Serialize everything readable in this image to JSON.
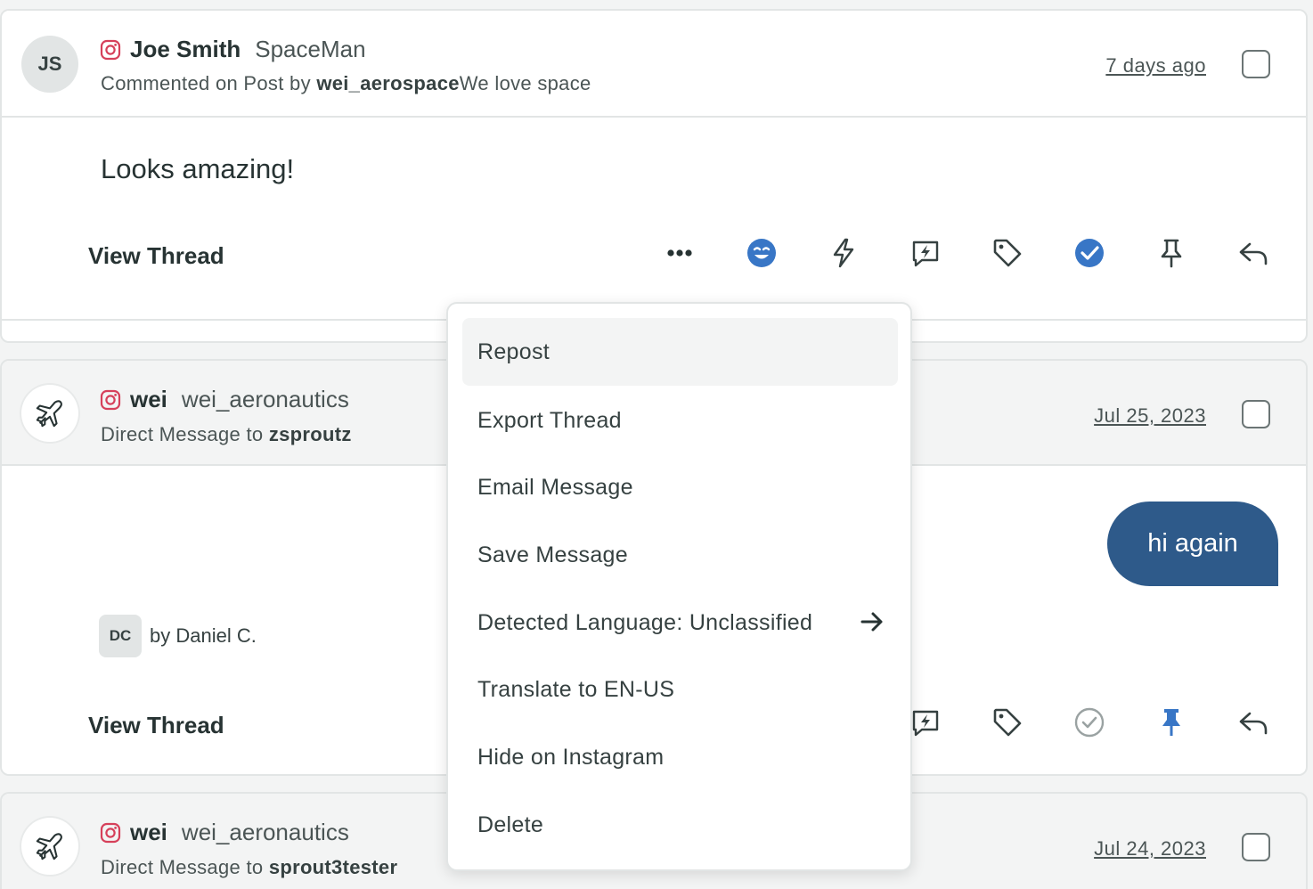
{
  "messages": [
    {
      "avatar": "JS",
      "network_icon": "instagram-icon",
      "name": "Joe Smith",
      "handle": "SpaceMan",
      "subtitle_prefix": "Commented on Post by ",
      "subtitle_bold": "wei_aerospace",
      "subtitle_suffix": "We love space",
      "date": "7 days ago",
      "body": "Looks amazing!",
      "view_thread": "View Thread"
    },
    {
      "avatar_icon": "airplane-icon",
      "network_icon": "instagram-icon",
      "name": "wei",
      "handle": "wei_aeronautics",
      "subtitle_prefix": "Direct Message to ",
      "subtitle_bold": "zsproutz",
      "date": "Jul 25, 2023",
      "bubble": "hi again",
      "assignee_initials": "DC",
      "assignee_text": "by Daniel C.",
      "view_thread": "View Thread"
    },
    {
      "avatar_icon": "airplane-icon",
      "network_icon": "instagram-icon",
      "name": "wei",
      "handle": "wei_aeronautics",
      "subtitle_prefix": "Direct Message to ",
      "subtitle_bold": "sprout3tester",
      "date": "Jul 24, 2023"
    }
  ],
  "menu": {
    "items": [
      "Repost",
      "Export Thread",
      "Email Message",
      "Save Message",
      "Detected Language: Unclassified",
      "Translate to EN-US",
      "Hide on Instagram",
      "Delete"
    ]
  },
  "colors": {
    "accent_blue": "#3876c6",
    "bubble": "#2e5a8a",
    "instagram": "#d6405a"
  }
}
